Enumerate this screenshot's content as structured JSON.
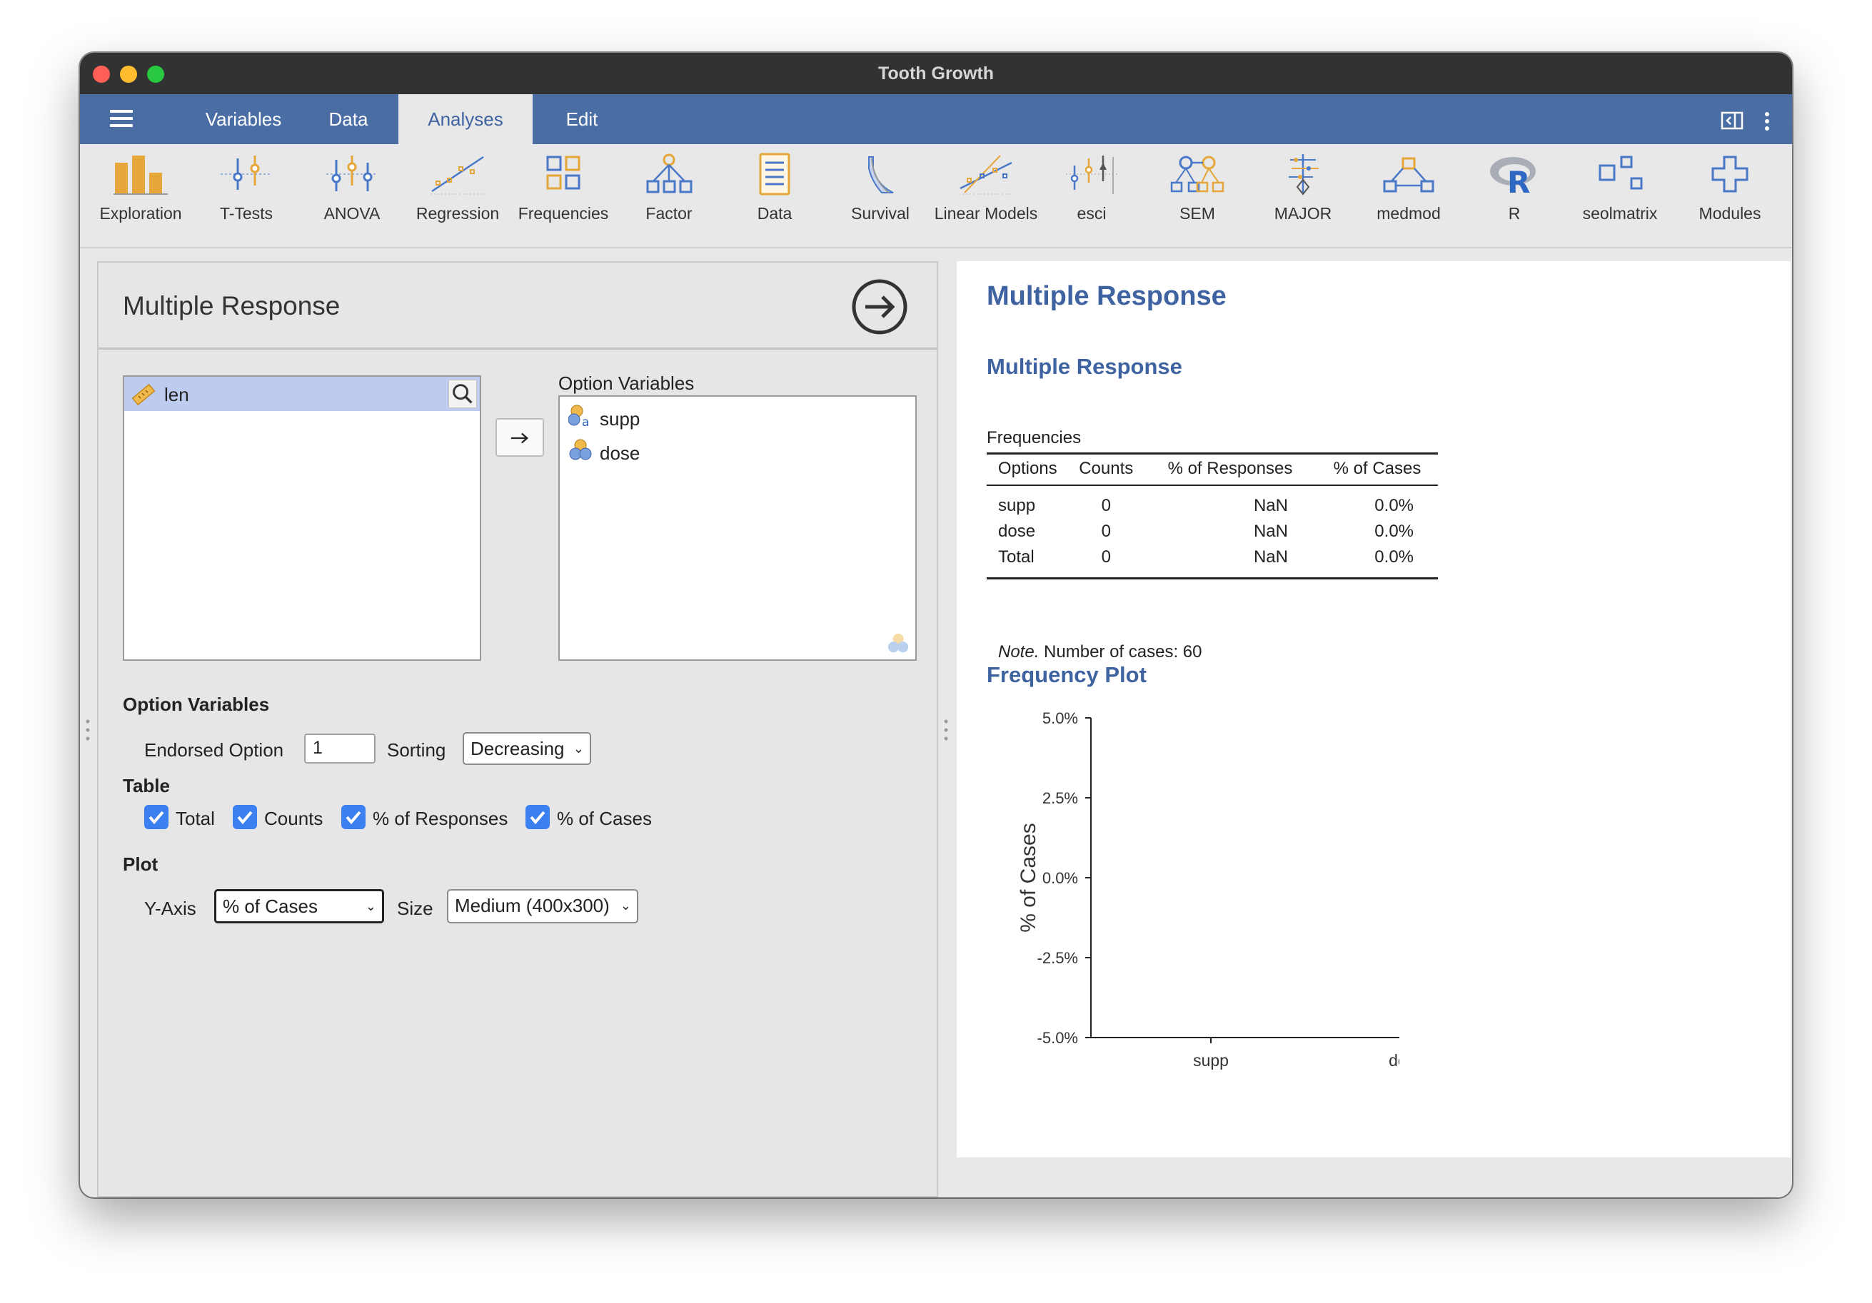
{
  "window": {
    "title": "Tooth Growth"
  },
  "menubar": {
    "tabs": [
      {
        "label": "Variables",
        "active": false
      },
      {
        "label": "Data",
        "active": false
      },
      {
        "label": "Analyses",
        "active": true
      },
      {
        "label": "Edit",
        "active": false
      }
    ]
  },
  "ribbon": {
    "items": [
      {
        "label": "Exploration",
        "icon": "bar-chart-icon"
      },
      {
        "label": "T-Tests",
        "icon": "t-tests-icon"
      },
      {
        "label": "ANOVA",
        "icon": "anova-icon"
      },
      {
        "label": "Regression",
        "icon": "regression-icon"
      },
      {
        "label": "Frequencies",
        "icon": "frequencies-icon"
      },
      {
        "label": "Factor",
        "icon": "factor-icon"
      },
      {
        "label": "Data",
        "icon": "data-icon"
      },
      {
        "label": "Survival",
        "icon": "survival-icon"
      },
      {
        "label": "Linear Models",
        "icon": "linear-models-icon"
      },
      {
        "label": "esci",
        "icon": "esci-icon"
      },
      {
        "label": "SEM",
        "icon": "sem-icon"
      },
      {
        "label": "MAJOR",
        "icon": "major-icon"
      },
      {
        "label": "medmod",
        "icon": "medmod-icon"
      },
      {
        "label": "R",
        "icon": "r-icon"
      },
      {
        "label": "seolmatrix",
        "icon": "seolmatrix-icon"
      },
      {
        "label": "Modules",
        "icon": "plus-icon"
      }
    ]
  },
  "options_panel": {
    "title": "Multiple Response",
    "available_variables": [
      "len"
    ],
    "option_variables_label": "Option Variables",
    "option_variables": [
      "supp",
      "dose"
    ],
    "option_section": {
      "heading": "Option Variables",
      "endorsed_label": "Endorsed Option",
      "endorsed_value": "1",
      "sorting_label": "Sorting",
      "sorting_value": "Decreasing"
    },
    "table_section": {
      "heading": "Table",
      "checkboxes": [
        {
          "label": "Total",
          "checked": true
        },
        {
          "label": "Counts",
          "checked": true
        },
        {
          "label": "% of Responses",
          "checked": true
        },
        {
          "label": "% of Cases",
          "checked": true
        }
      ]
    },
    "plot_section": {
      "heading": "Plot",
      "yaxis_label": "Y-Axis",
      "yaxis_value": "% of Cases",
      "size_label": "Size",
      "size_value": "Medium (400x300)"
    }
  },
  "results": {
    "title": "Multiple Response",
    "table_heading": "Multiple Response",
    "table_caption": "Frequencies",
    "columns": [
      "Options",
      "Counts",
      "% of Responses",
      "% of Cases"
    ],
    "rows": [
      [
        "supp",
        "0",
        "NaN",
        "0.0%"
      ],
      [
        "dose",
        "0",
        "NaN",
        "0.0%"
      ],
      [
        "Total",
        "0",
        "NaN",
        "0.0%"
      ]
    ],
    "note_label": "Note.",
    "note_text": " Number of cases: 60",
    "plot_heading": "Frequency Plot"
  },
  "chart_data": {
    "type": "bar",
    "categories": [
      "supp",
      "dose"
    ],
    "values": [
      0,
      0
    ],
    "ylabel": "% of Cases",
    "xlabel": "",
    "ylim": [
      -5,
      5
    ],
    "yticks": [
      "5.0%",
      "2.5%",
      "0.0%",
      "-2.5%",
      "-5.0%"
    ],
    "ytick_values": [
      5,
      2.5,
      0,
      -2.5,
      -5
    ]
  },
  "colors": {
    "menubar": "#4a6da4",
    "accent": "#3e63a0",
    "selected_row": "#bccbee",
    "checkbox": "#3b7ff0"
  }
}
